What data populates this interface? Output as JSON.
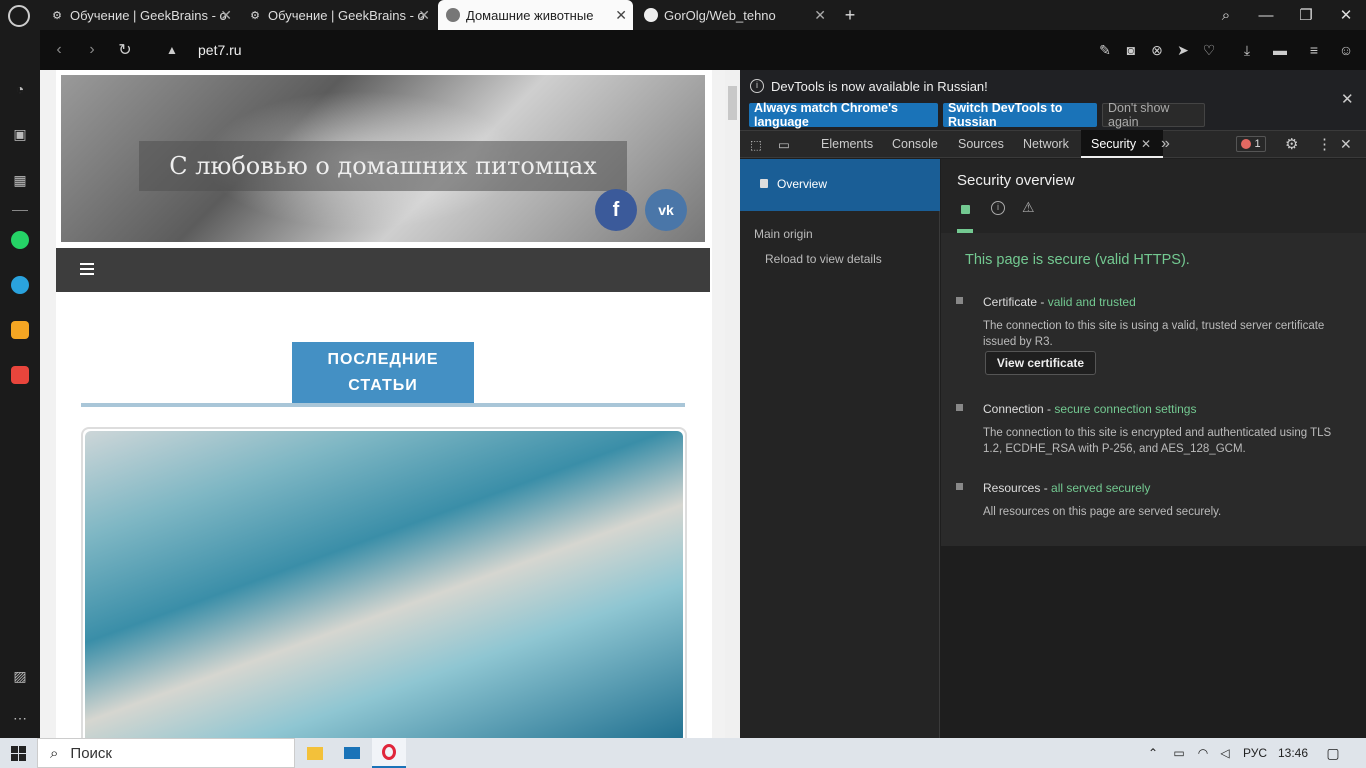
{
  "tabs": [
    {
      "title": "Обучение | GeekBrains - о",
      "favicon": "gear-icon"
    },
    {
      "title": "Обучение | GeekBrains - о",
      "favicon": "gear-icon"
    },
    {
      "title": "Домашние животные",
      "favicon": "pet-icon"
    },
    {
      "title": "GorOlg/Web_tehno",
      "favicon": "github-icon"
    }
  ],
  "new_tab": "+",
  "address": {
    "url": "pet7.ru"
  },
  "site": {
    "title": "С любовью о домашних питомцах",
    "social": [
      "f",
      "vk"
    ],
    "latest_label_line1": "ПОСЛЕДНИЕ",
    "latest_label_line2": "СТАТЬИ"
  },
  "devtools": {
    "banner": "DevTools is now available in Russian!",
    "btn_match": "Always match Chrome's language",
    "btn_switch": "Switch DevTools to Russian",
    "btn_dont": "Don't show again",
    "tabs": [
      "Elements",
      "Console",
      "Sources",
      "Network",
      "Security"
    ],
    "error_count": "1",
    "overview": "Overview",
    "main_origin": "Main origin",
    "reload": "Reload to view details",
    "sec_title": "Security overview",
    "secure_msg": "This page is secure (valid HTTPS).",
    "cert_label": "Certificate -",
    "cert_status": "valid and trusted",
    "cert_desc": "The connection to this site is using a valid, trusted server certificate issued by R3.",
    "view_cert": "View certificate",
    "conn_label": "Connection -",
    "conn_status": "secure connection settings",
    "conn_desc": "The connection to this site is encrypted and authenticated using TLS 1.2, ECDHE_RSA with P-256, and AES_128_GCM.",
    "res_label": "Resources -",
    "res_status": "all served securely",
    "res_desc": "All resources on this page are served securely."
  },
  "taskbar": {
    "search": "Поиск",
    "lang": "РУС",
    "time": "13:46"
  },
  "colors": {
    "accent": "#1a73b8",
    "secure": "#73c991",
    "site_blue": "#4490c4"
  }
}
